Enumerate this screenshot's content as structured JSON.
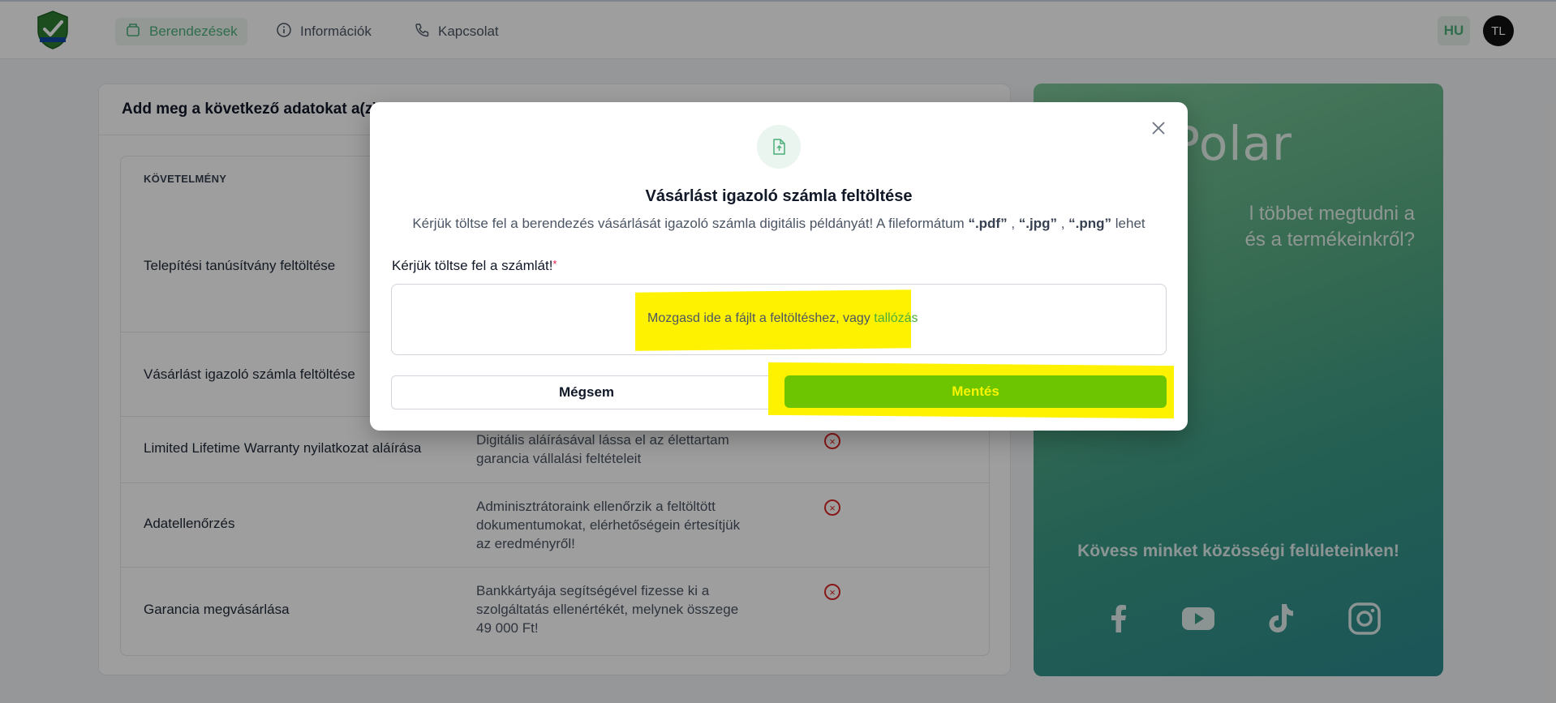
{
  "header": {
    "nav": [
      {
        "label": "Berendezések",
        "icon": "box-icon",
        "active": true
      },
      {
        "label": "Információk",
        "icon": "info-icon",
        "active": false
      },
      {
        "label": "Kapcsolat",
        "icon": "phone-icon",
        "active": false
      }
    ],
    "language": "HU",
    "avatar_initials": "TL"
  },
  "main": {
    "title": "Add meg a következő adatokat a(z) ...",
    "table_header": "KÖVETELMÉNY",
    "rows": [
      {
        "label": "Telepítési tanúsítvány feltöltése",
        "description": "",
        "status": ""
      },
      {
        "label": "Vásárlást igazoló számla feltöltése",
        "description": "",
        "status": ""
      },
      {
        "label": "Limited Lifetime Warranty nyilatkozat aláírása",
        "description": "Digitális aláírásával lássa el az élettartam garancia vállalási feltételeit",
        "status": "×"
      },
      {
        "label": "Adatellenőrzés",
        "description": "Adminisztrátoraink ellenőrzik a feltöltött dokumentumokat, elérhetőségein értesítjük az eredményről!",
        "status": "×"
      },
      {
        "label": "Garancia megvásárlása",
        "description": "Bankkártyája segítségével fizesse ki a szolgáltatás ellenértékét, melynek összege 49 000 Ft!",
        "status": "×"
      }
    ]
  },
  "promo": {
    "brand": "Polar",
    "text_line1": "l többet megtudni a",
    "text_line2": "és a termékeinkről?",
    "social_title": "Kövess minket közösségi felületeinken!",
    "social": [
      "facebook-icon",
      "youtube-icon",
      "tiktok-icon",
      "instagram-icon"
    ]
  },
  "modal": {
    "title": "Vásárlást igazoló számla feltöltése",
    "subtitle_prefix": "Kérjük töltse fel a berendezés vásárlását igazoló számla digitális példányát! A fileformátum",
    "formats": [
      "“.pdf”",
      "“.jpg”",
      "“.png”"
    ],
    "subtitle_suffix": "lehet",
    "field_label": "Kérjük töltse fel a számlát!",
    "required_mark": "*",
    "dropzone_text": "Mozgasd ide a fájlt a feltöltéshez, vagy",
    "browse_link": "tallózás",
    "cancel_label": "Mégsem",
    "save_label": "Mentés"
  },
  "colors": {
    "accent_green": "#4caf7a",
    "save_button": "#6dc400",
    "highlight": "#fff200",
    "error_red": "#dc2626"
  }
}
